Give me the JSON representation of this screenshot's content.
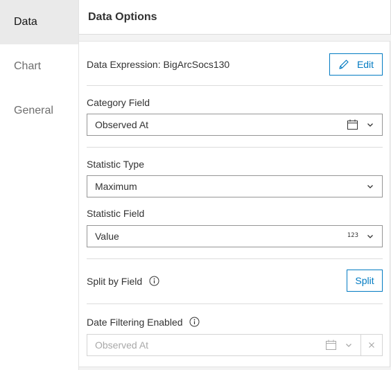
{
  "sidebar": {
    "items": [
      {
        "label": "Data",
        "active": true
      },
      {
        "label": "Chart",
        "active": false
      },
      {
        "label": "General",
        "active": false
      }
    ]
  },
  "panel": {
    "title": "Data Options",
    "data_expression": {
      "label": "Data Expression: BigArcSocs130",
      "edit_button": "Edit",
      "edit_icon": "pencil-icon"
    },
    "category_field": {
      "label": "Category Field",
      "value": "Observed At",
      "type_icon": "calendar-icon"
    },
    "statistic_type": {
      "label": "Statistic Type",
      "value": "Maximum"
    },
    "statistic_field": {
      "label": "Statistic Field",
      "value": "Value",
      "type_badge": "123"
    },
    "split_by_field": {
      "label": "Split by Field",
      "button": "Split"
    },
    "date_filtering": {
      "label": "Date Filtering Enabled",
      "placeholder": "Observed At"
    }
  },
  "colors": {
    "accent": "#007ac2",
    "active_nav_bg": "#eaeaea",
    "panel_bg": "#f3f3f3"
  }
}
